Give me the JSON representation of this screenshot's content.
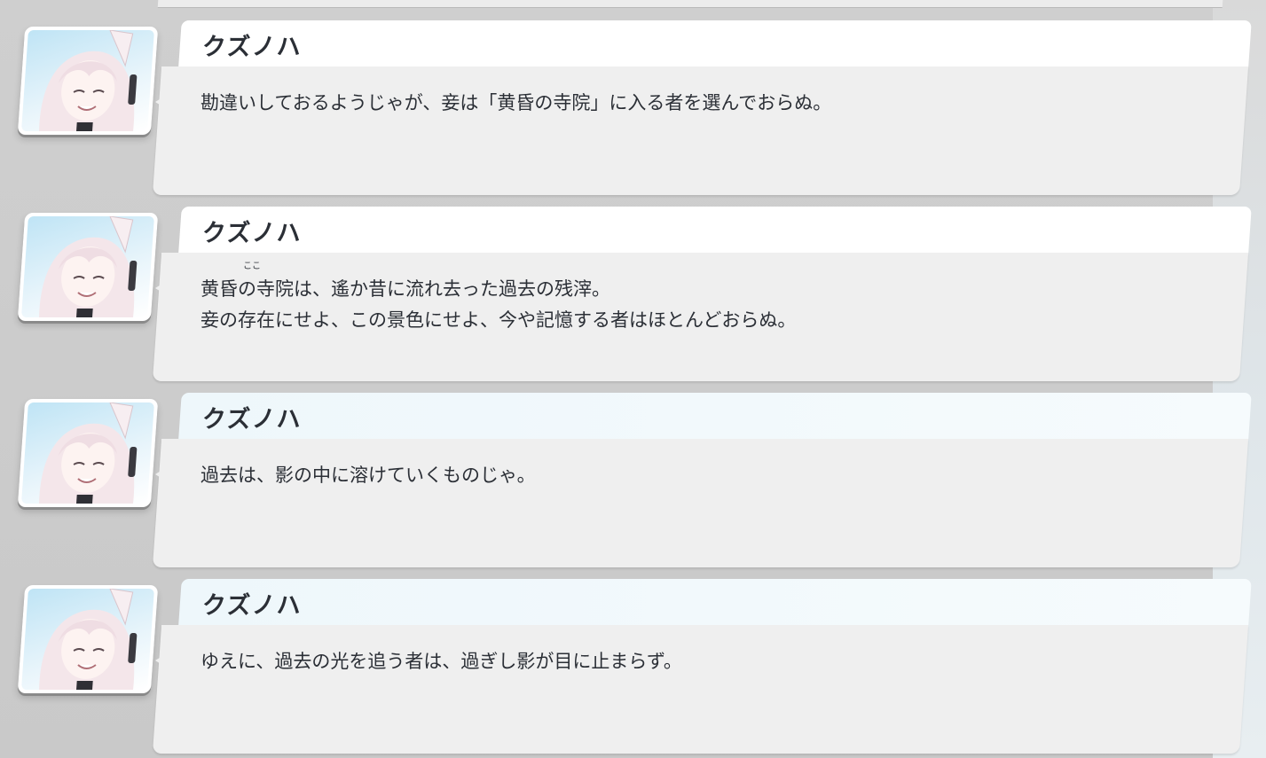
{
  "colors": {
    "text": "#2b2f36",
    "message_bg": "#efefef",
    "name_bg": "#ffffff",
    "name_bg_highlight": "#eef7fb",
    "backdrop": "#c9c9c9"
  },
  "log": [
    {
      "speaker": "クズノハ",
      "portrait_icon": "kuzunoha-portrait",
      "lines": [
        "勘違いしておるようじゃが、妾は「黄昏の寺院」に入る者を選んでおらぬ。"
      ]
    },
    {
      "speaker": "クズノハ",
      "portrait_icon": "kuzunoha-portrait",
      "furigana": "ここ",
      "lines": [
        "黄昏の寺院は、遙か昔に流れ去った過去の残滓。",
        "妾の存在にせよ、この景色にせよ、今や記憶する者はほとんどおらぬ。"
      ]
    },
    {
      "speaker": "クズノハ",
      "portrait_icon": "kuzunoha-portrait",
      "lines": [
        "過去は、影の中に溶けていくものじゃ。"
      ]
    },
    {
      "speaker": "クズノハ",
      "portrait_icon": "kuzunoha-portrait",
      "lines": [
        "ゆえに、過去の光を追う者は、過ぎし影が目に止まらず。"
      ]
    }
  ]
}
